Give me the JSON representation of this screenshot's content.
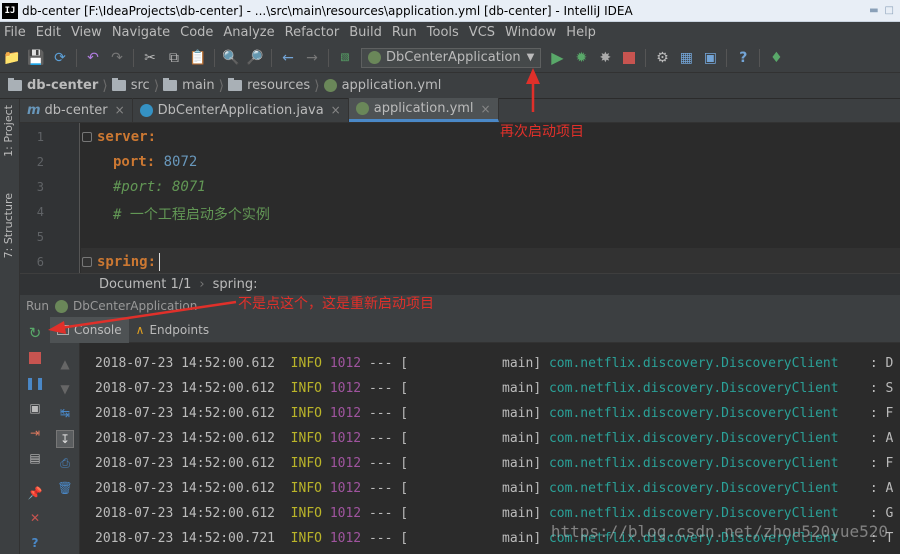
{
  "title_bar": {
    "app_icon_text": "IJ",
    "title": "db-center [F:\\IdeaProjects\\db-center] - ...\\src\\main\\resources\\application.yml [db-center] - IntelliJ IDEA"
  },
  "menu": {
    "items": [
      "File",
      "Edit",
      "View",
      "Navigate",
      "Code",
      "Analyze",
      "Refactor",
      "Build",
      "Run",
      "Tools",
      "VCS",
      "Window",
      "Help"
    ]
  },
  "toolbar": {
    "run_config_label": "DbCenterApplication"
  },
  "breadcrumb": {
    "items": [
      "db-center",
      "src",
      "main",
      "resources",
      "application.yml"
    ]
  },
  "left_strip": {
    "project_label": "1: Project",
    "structure_label": "7: Structure"
  },
  "tabs": [
    {
      "label": "db-center",
      "active": false
    },
    {
      "label": "DbCenterApplication.java",
      "active": false
    },
    {
      "label": "application.yml",
      "active": true
    }
  ],
  "editor": {
    "lines": [
      {
        "no": "1",
        "text": "server:"
      },
      {
        "no": "2",
        "key": "port:",
        "value": "8072"
      },
      {
        "no": "3",
        "text": "#port: 8071"
      },
      {
        "no": "4",
        "text": "# 一个工程启动多个实例"
      },
      {
        "no": "5",
        "text": ""
      },
      {
        "no": "6",
        "text": "spring:"
      }
    ]
  },
  "doc_status": {
    "document": "Document 1/1",
    "path": "spring:"
  },
  "run_panel": {
    "header": "Run",
    "config_name": "DbCenterApplication",
    "tabs": [
      "Console",
      "Endpoints"
    ]
  },
  "console": {
    "lines": [
      {
        "ts": "2018-07-23 14:52:00.612",
        "level": "INFO",
        "pid": "1012",
        "sep": "--- [",
        "thread": "main]",
        "cls": "com.netflix.discovery.DiscoveryClient",
        "tail": ": D"
      },
      {
        "ts": "2018-07-23 14:52:00.612",
        "level": "INFO",
        "pid": "1012",
        "sep": "--- [",
        "thread": "main]",
        "cls": "com.netflix.discovery.DiscoveryClient",
        "tail": ": S"
      },
      {
        "ts": "2018-07-23 14:52:00.612",
        "level": "INFO",
        "pid": "1012",
        "sep": "--- [",
        "thread": "main]",
        "cls": "com.netflix.discovery.DiscoveryClient",
        "tail": ": F"
      },
      {
        "ts": "2018-07-23 14:52:00.612",
        "level": "INFO",
        "pid": "1012",
        "sep": "--- [",
        "thread": "main]",
        "cls": "com.netflix.discovery.DiscoveryClient",
        "tail": ": A"
      },
      {
        "ts": "2018-07-23 14:52:00.612",
        "level": "INFO",
        "pid": "1012",
        "sep": "--- [",
        "thread": "main]",
        "cls": "com.netflix.discovery.DiscoveryClient",
        "tail": ": F"
      },
      {
        "ts": "2018-07-23 14:52:00.612",
        "level": "INFO",
        "pid": "1012",
        "sep": "--- [",
        "thread": "main]",
        "cls": "com.netflix.discovery.DiscoveryClient",
        "tail": ": A"
      },
      {
        "ts": "2018-07-23 14:52:00.612",
        "level": "INFO",
        "pid": "1012",
        "sep": "--- [",
        "thread": "main]",
        "cls": "com.netflix.discovery.DiscoveryClient",
        "tail": ": G"
      },
      {
        "ts": "2018-07-23 14:52:00.721",
        "level": "INFO",
        "pid": "1012",
        "sep": "--- [",
        "thread": "main]",
        "cls": "com.netflix.discovery.DiscoveryClient",
        "tail": ": T"
      }
    ]
  },
  "annotations": {
    "rerun_note": "再次启动项目",
    "restart_note": "不是点这个，这是重新启动项目"
  },
  "watermark": "https://blog.csdn.net/zhou520yue520",
  "colors": {
    "accent_tab": "#4a88c7",
    "annotation_red": "#e0302a",
    "run_green": "#59a869"
  }
}
